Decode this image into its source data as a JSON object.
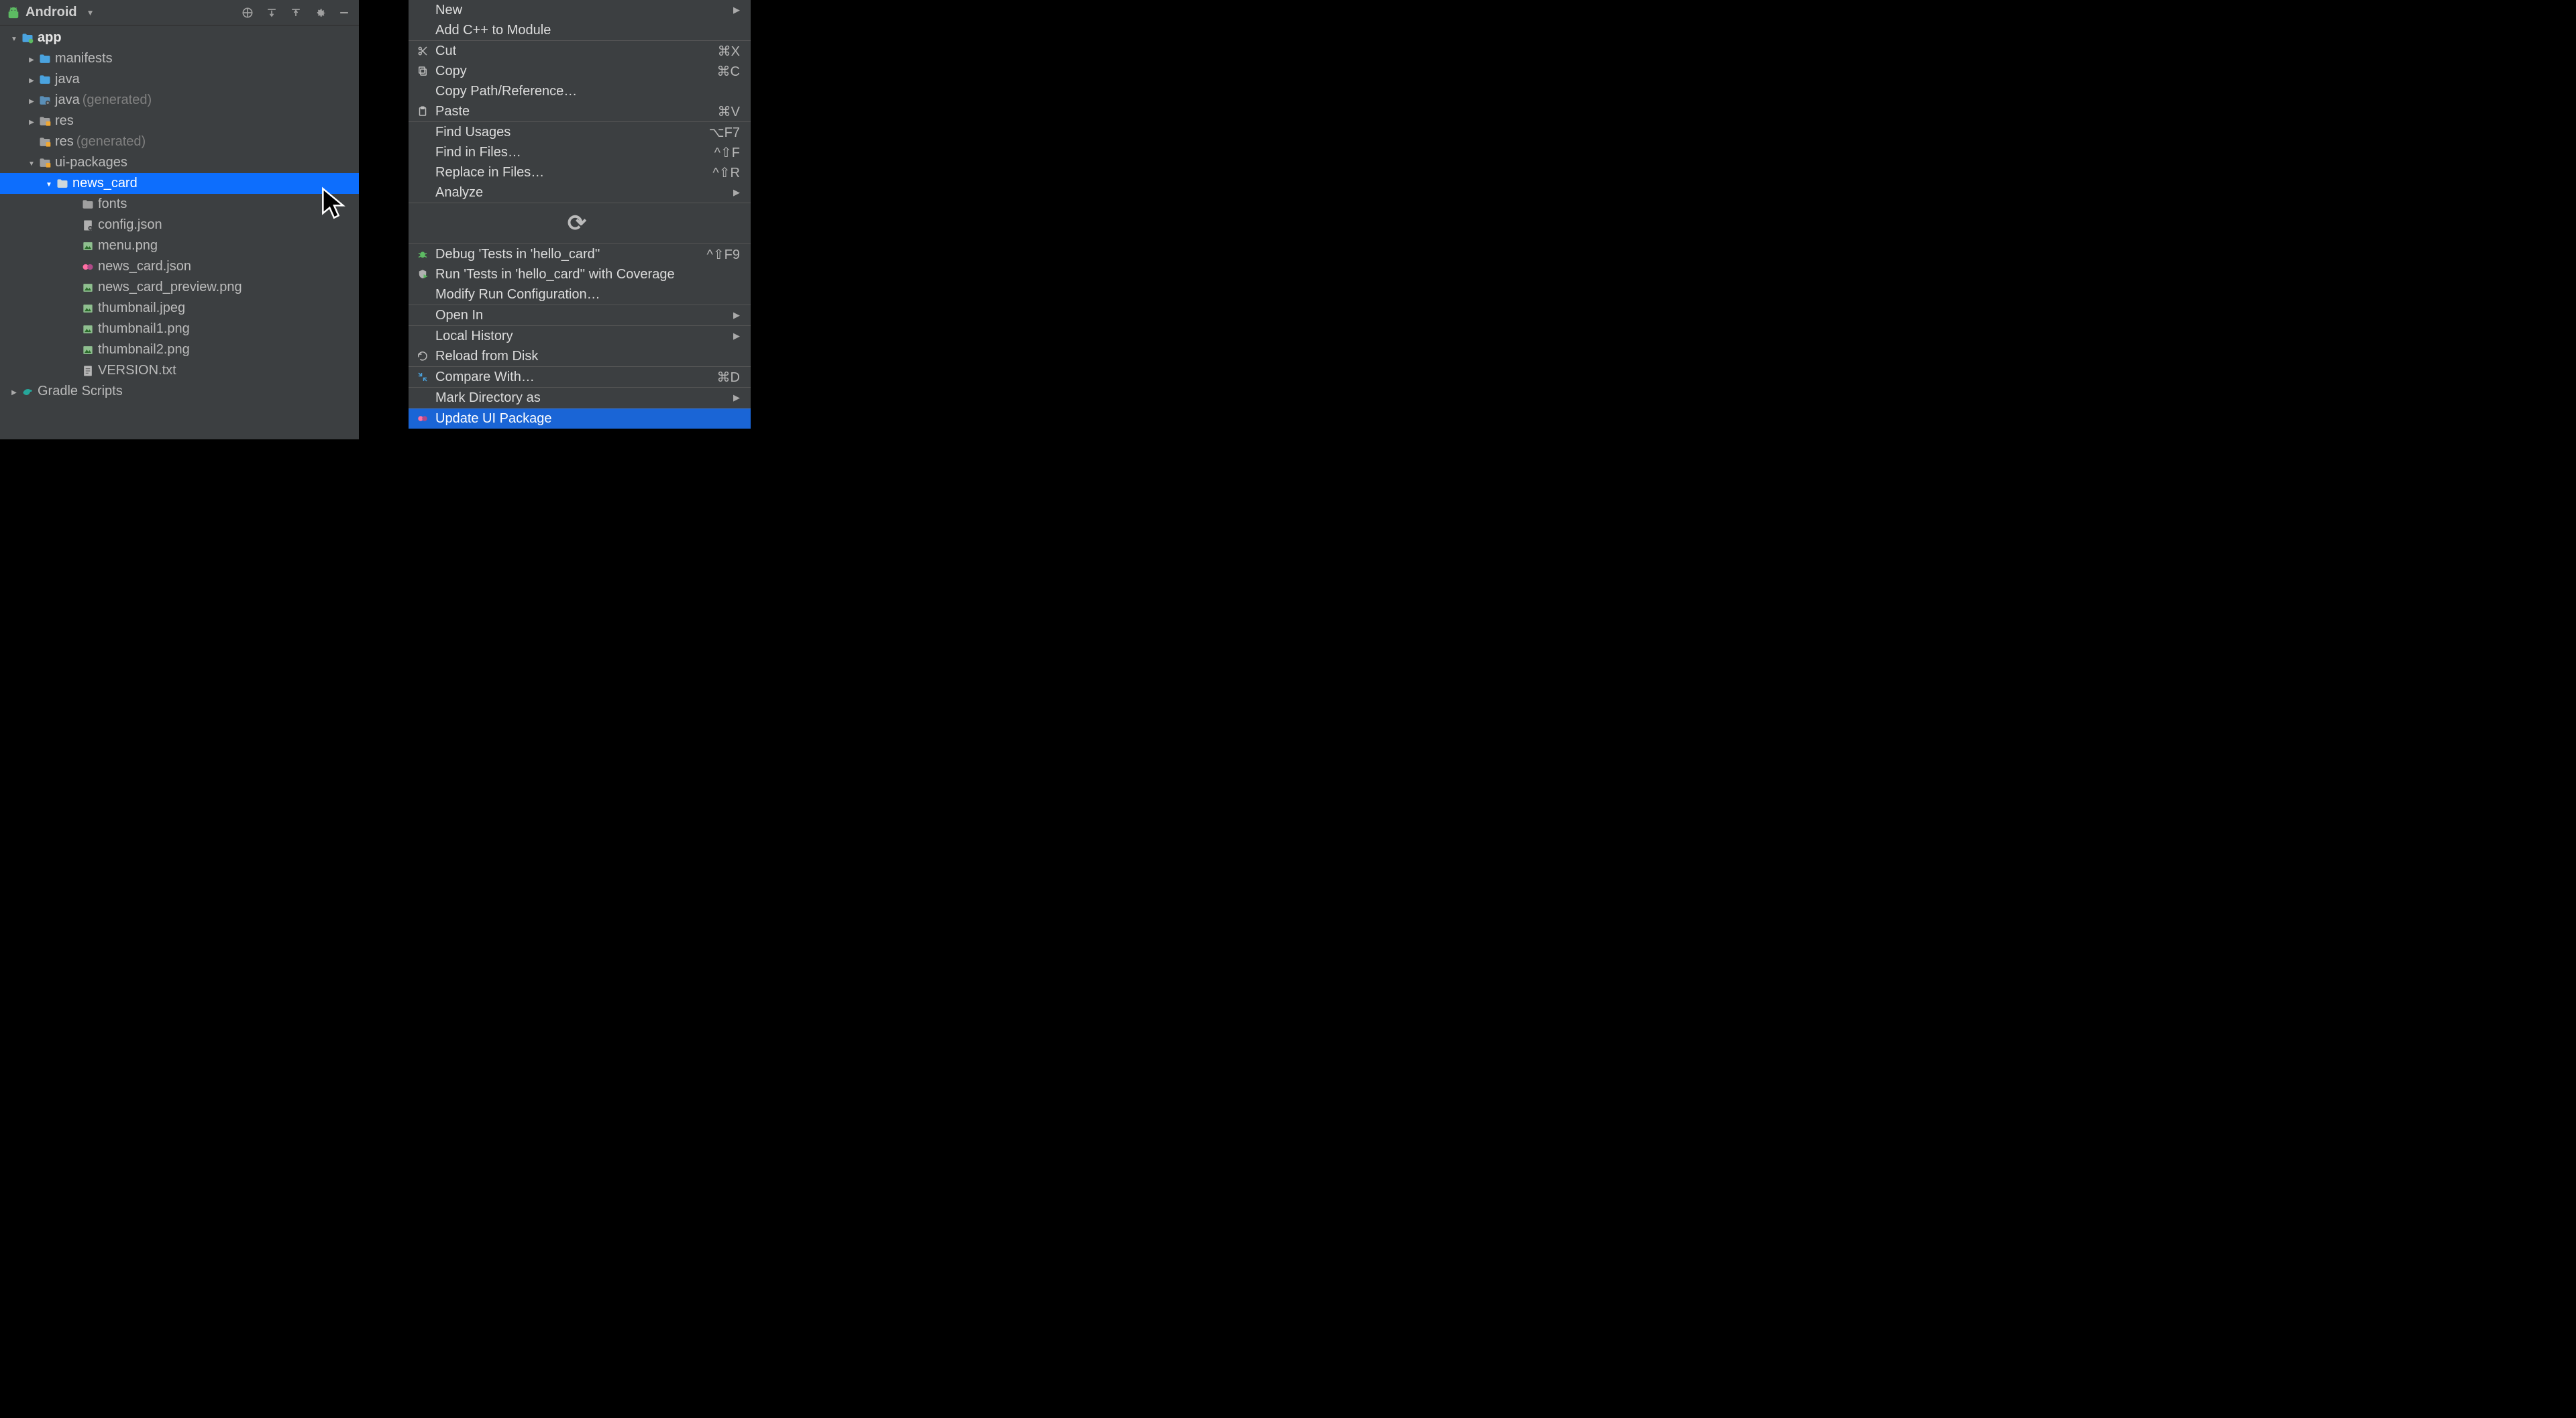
{
  "panel": {
    "title": "Android"
  },
  "tree": {
    "app": {
      "label": "app"
    },
    "manifests": {
      "label": "manifests"
    },
    "java": {
      "label": "java"
    },
    "java_gen": {
      "label": "java",
      "hint": "(generated)"
    },
    "res": {
      "label": "res"
    },
    "res_gen": {
      "label": "res",
      "hint": "(generated)"
    },
    "ui_packages": {
      "label": "ui-packages"
    },
    "news_card": {
      "label": "news_card"
    },
    "fonts": {
      "label": "fonts"
    },
    "config_json": {
      "label": "config.json"
    },
    "menu_png": {
      "label": "menu.png"
    },
    "news_card_json": {
      "label": "news_card.json"
    },
    "news_card_preview": {
      "label": "news_card_preview.png"
    },
    "thumbnail_jpeg": {
      "label": "thumbnail.jpeg"
    },
    "thumbnail1_png": {
      "label": "thumbnail1.png"
    },
    "thumbnail2_png": {
      "label": "thumbnail2.png"
    },
    "version_txt": {
      "label": "VERSION.txt"
    },
    "gradle_scripts": {
      "label": "Gradle Scripts"
    }
  },
  "menu": {
    "new": {
      "label": "New"
    },
    "add_cpp": {
      "label": "Add C++ to Module"
    },
    "cut": {
      "label": "Cut",
      "shortcut": "⌘X"
    },
    "copy": {
      "label": "Copy",
      "shortcut": "⌘C"
    },
    "copy_path": {
      "label": "Copy Path/Reference…"
    },
    "paste": {
      "label": "Paste",
      "shortcut": "⌘V"
    },
    "find_usages": {
      "label": "Find Usages",
      "shortcut": "⌥F7"
    },
    "find_in_files": {
      "label": "Find in Files…",
      "shortcut": "^⇧F"
    },
    "replace_in_files": {
      "label": "Replace in Files…",
      "shortcut": "^⇧R"
    },
    "analyze": {
      "label": "Analyze"
    },
    "debug_tests": {
      "label": "Debug 'Tests in 'hello_card''",
      "shortcut": "^⇧F9"
    },
    "run_coverage": {
      "label": "Run 'Tests in 'hello_card'' with Coverage"
    },
    "modify_run": {
      "label": "Modify Run Configuration…"
    },
    "open_in": {
      "label": "Open In"
    },
    "local_history": {
      "label": "Local History"
    },
    "reload": {
      "label": "Reload from Disk"
    },
    "compare": {
      "label": "Compare With…",
      "shortcut": "⌘D"
    },
    "mark_dir": {
      "label": "Mark Directory as"
    },
    "update_ui": {
      "label": "Update UI Package"
    }
  }
}
